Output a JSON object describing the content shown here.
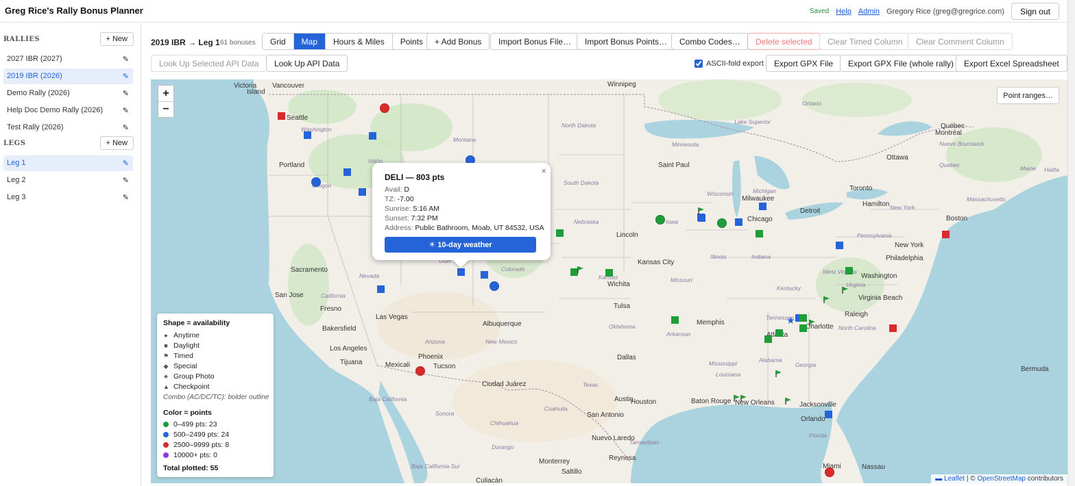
{
  "app": {
    "title": "Greg Rice's Rally Bonus Planner",
    "saved": "Saved",
    "help": "Help",
    "admin": "Admin",
    "user": "Gregory Rice (greg@gregrice.com)",
    "signout": "Sign out"
  },
  "sidebar": {
    "rallies_title": "RALLIES",
    "legs_title": "LEGS",
    "new_label": "+ New",
    "rallies": [
      "2027 IBR (2027)",
      "2019 IBR (2026)",
      "Demo Rally (2026)",
      "Help Doc Demo Rally (2026)",
      "Test Rally (2026)"
    ],
    "legs": [
      "Leg 1",
      "Leg 2",
      "Leg 3"
    ],
    "edit_icon": "pencil-icon"
  },
  "toolbar": {
    "crumb": "2019 IBR → Leg 1",
    "count": "61 bonuses",
    "tabs": [
      "Grid",
      "Map",
      "Hours & Miles",
      "Points"
    ],
    "active_tab": "Map",
    "add_bonus": "+ Add Bonus",
    "import_file": "Import Bonus File…",
    "import_points": "Import Bonus Points…",
    "combo": "Combo Codes…",
    "delete": "Delete selected",
    "clear_timed": "Clear Timed Column",
    "clear_comment": "Clear Comment Column",
    "lookup_selected": "Look Up Selected API Data",
    "lookup": "Look Up API Data",
    "ascii": "ASCII-fold export",
    "gpx": "Export GPX File",
    "gpx_whole": "Export GPX File (whole rally)",
    "excel": "Export Excel Spreadsheet"
  },
  "map": {
    "zoom_in": "+",
    "zoom_out": "−",
    "point_ranges": "Point ranges…",
    "attribution_leaflet": "Leaflet",
    "attribution_sep": " | © ",
    "attribution_osm": "OpenStreetMap",
    "attribution_tail": " contributors",
    "cities": [
      {
        "t": "Vancouver"
      },
      {
        "t": "Victoria"
      },
      {
        "t": "Island"
      },
      {
        "t": "Seattle"
      },
      {
        "t": "Portland"
      },
      {
        "t": "Winnipeg"
      },
      {
        "t": "Saint Paul"
      },
      {
        "t": "Milwaukee"
      },
      {
        "t": "Chicago"
      },
      {
        "t": "Detroit"
      },
      {
        "t": "Toronto"
      },
      {
        "t": "Hamilton"
      },
      {
        "t": "Ottawa"
      },
      {
        "t": "Montréal"
      },
      {
        "t": "Québec"
      },
      {
        "t": "Boston"
      },
      {
        "t": "New York"
      },
      {
        "t": "Philadelphia"
      },
      {
        "t": "Washington"
      },
      {
        "t": "Virginia Beach"
      },
      {
        "t": "Raleigh"
      },
      {
        "t": "Charlotte"
      },
      {
        "t": "Atlanta"
      },
      {
        "t": "Jacksonville"
      },
      {
        "t": "Orlando"
      },
      {
        "t": "Miami"
      },
      {
        "t": "Nassau"
      },
      {
        "t": "Bermuda"
      },
      {
        "t": "Memphis"
      },
      {
        "t": "Tulsa"
      },
      {
        "t": "Kansas City"
      },
      {
        "t": "Wichita"
      },
      {
        "t": "Lincoln"
      },
      {
        "t": "Dallas"
      },
      {
        "t": "Austin"
      },
      {
        "t": "Houston"
      },
      {
        "t": "San Antonio"
      },
      {
        "t": "Baton Rouge"
      },
      {
        "t": "New Orleans"
      },
      {
        "t": "Nuevo Laredo"
      },
      {
        "t": "Monterrey"
      },
      {
        "t": "Reynosa"
      },
      {
        "t": "Saltillo"
      },
      {
        "t": "Culiacán"
      },
      {
        "t": "Ciudad Juárez"
      },
      {
        "t": "Albuquerque"
      },
      {
        "t": "Phoenix"
      },
      {
        "t": "Tucson"
      },
      {
        "t": "Mexicali"
      },
      {
        "t": "Tijuana"
      },
      {
        "t": "Los Angeles"
      },
      {
        "t": "Bakersfield"
      },
      {
        "t": "Fresno"
      },
      {
        "t": "Las Vegas"
      },
      {
        "t": "San Jose"
      },
      {
        "t": "Sacramento"
      }
    ],
    "states": [
      {
        "t": "Washington"
      },
      {
        "t": "Idaho"
      },
      {
        "t": "Montana"
      },
      {
        "t": "North Dakota"
      },
      {
        "t": "South Dakota"
      },
      {
        "t": "Nebraska"
      },
      {
        "t": "Iowa"
      },
      {
        "t": "Illinois"
      },
      {
        "t": "Indiana"
      },
      {
        "t": "Michigan"
      },
      {
        "t": "Missouri"
      },
      {
        "t": "Kentucky"
      },
      {
        "t": "Tennessee"
      },
      {
        "t": "Arkansas"
      },
      {
        "t": "Oklahoma"
      },
      {
        "t": "Texas"
      },
      {
        "t": "Mississippi"
      },
      {
        "t": "Alabama"
      },
      {
        "t": "Georgia"
      },
      {
        "t": "Louisiana"
      },
      {
        "t": "Florida"
      },
      {
        "t": "North Carolina"
      },
      {
        "t": "Virginia"
      },
      {
        "t": "West Virginia"
      },
      {
        "t": "Pennsylvania"
      },
      {
        "t": "New York"
      },
      {
        "t": "Arizona"
      },
      {
        "t": "New Mexico"
      },
      {
        "t": "Nevada"
      },
      {
        "t": "California"
      },
      {
        "t": "Colorado"
      },
      {
        "t": "Kansas"
      },
      {
        "t": "Sonora"
      },
      {
        "t": "Chihuahua"
      },
      {
        "t": "Coahuila"
      },
      {
        "t": "Durango"
      },
      {
        "t": "Baja California"
      },
      {
        "t": "Baja California Sur"
      },
      {
        "t": "Tamaulipas"
      },
      {
        "t": "Nuevo Brunswick"
      },
      {
        "t": "Maine"
      },
      {
        "t": "Halifa"
      },
      {
        "t": "Utah"
      },
      {
        "t": "Oregon"
      },
      {
        "t": "Lake Superior"
      },
      {
        "t": "Ontario"
      },
      {
        "t": "Quebec"
      },
      {
        "t": "Massachusetts"
      },
      {
        "t": "Wisconsin"
      },
      {
        "t": "Minnesota"
      }
    ]
  },
  "popup": {
    "title": "DELI — 803 pts",
    "avail_k": "Avail:",
    "avail_v": "D",
    "tz_k": "TZ:",
    "tz_v": "-7.00",
    "sunrise_k": "Sunrise:",
    "sunrise_v": "5:16 AM",
    "sunset_k": "Sunset:",
    "sunset_v": "7:32 PM",
    "address_k": "Address:",
    "address_v": "Public Bathroom, Moab, UT 84532, USA",
    "weather": "☀ 10-day weather",
    "close": "×"
  },
  "legend": {
    "shape_title": "Shape = availability",
    "shapes": [
      {
        "sym": "●",
        "label": "Anytime"
      },
      {
        "sym": "■",
        "label": "Daylight"
      },
      {
        "sym": "⚑",
        "label": "Timed"
      },
      {
        "sym": "◆",
        "label": "Special"
      },
      {
        "sym": "★",
        "label": "Group Photo"
      },
      {
        "sym": "▲",
        "label": "Checkpoint"
      }
    ],
    "combo_note": "Combo (AC/DC/TC): bolder outline",
    "color_title": "Color = points",
    "colors": [
      {
        "color": "#1f9d3a",
        "label": "0–499 pts: 23"
      },
      {
        "color": "#2563d9",
        "label": "500–2499 pts: 24"
      },
      {
        "color": "#d92b2b",
        "label": "2500–9999 pts: 8"
      },
      {
        "color": "#8a3be0",
        "label": "10000+ pts: 0"
      }
    ],
    "total": "Total plotted: 55"
  },
  "colors": {
    "green": "#1f9d3a",
    "blue": "#2563d9",
    "red": "#d92b2b",
    "purple": "#8a3be0"
  }
}
